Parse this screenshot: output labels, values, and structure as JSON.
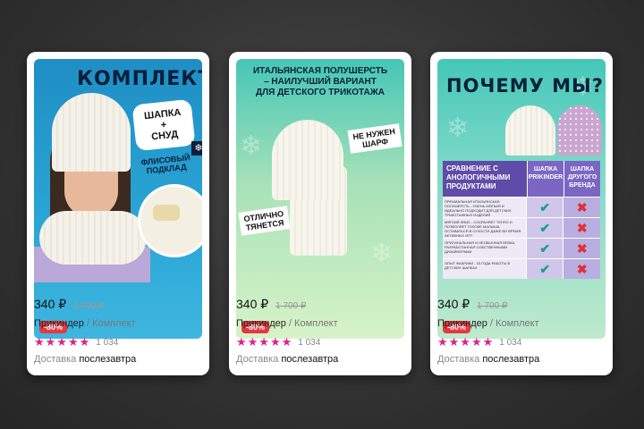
{
  "cards": [
    {
      "image": {
        "headline": "КОМПЛЕКТ",
        "bubble_line1": "ШАПКА",
        "bubble_line2": "+",
        "bubble_line3": "СНУД",
        "badge_line1": "ФЛИСОВЫЙ",
        "badge_line2": "ПОДКЛАД"
      },
      "discount": "-80%",
      "price": "340 ₽",
      "old_price": "1 700 ₽",
      "brand": "Прикиндер",
      "separator": "/",
      "category": "Комплект",
      "rating_count": "1 034",
      "delivery_label": "Доставка",
      "delivery_value": "послезавтра"
    },
    {
      "image": {
        "headline_line1": "ИТАЛЬЯНСКАЯ ПОЛУШЕРСТЬ",
        "headline_line2": "– НАИЛУЧШИЙ ВАРИАНТ",
        "headline_line3": "ДЛЯ ДЕТСКОГО ТРИКОТАЖА",
        "tag1_line1": "НЕ НУЖЕН",
        "tag1_line2": "ШАРФ",
        "tag2_line1": "ОТЛИЧНО",
        "tag2_line2": "ТЯНЕТСЯ"
      },
      "discount": "-80%",
      "price": "340 ₽",
      "old_price": "1 700 ₽",
      "brand": "Прикиндер",
      "separator": "/",
      "category": "Комплект",
      "rating_count": "1 034",
      "delivery_label": "Доставка",
      "delivery_value": "послезавтра"
    },
    {
      "image": {
        "headline": "ПОЧЕМУ МЫ?",
        "table_header": "СРАВНЕНИЕ С АНОЛОГИЧНЫМИ ПРОДУКТАМИ",
        "col1": "ШАПКА PRIKINDER",
        "col2": "ШАПКА ДРУГОГО БРЕНДА",
        "rows": [
          "ПРЕМИАЛЬНАЯ ИТАЛЬЯНСКАЯ ПОЛУШЕРСТЬ - ОЧЕНЬ МЯГКАЯ И ИДЕАЛЬНО ПОДХОДИТ ДЛЯ ДЕТСКИХ ТРИКОТАЖНЫХ ИЗДЕЛИЙ",
          "МЯГКИЙ ФЛИС - СОХРАНЯЕТ ТЕПЛО И ПОЗВОЛЯЕТ ГОЛОВЕ МАЛЫША ОСТАВАТЬСЯ В СУХОСТИ ДАЖЕ ВО ВРЕМЯ АКТИВНЫХ ИГР",
          "ОРИГИНАЛЬНАЯ И НЕОБЫЧНАЯ ВЯЗКА, РАЗРАБОТАННАЯ СОБСТВЕННЫМИ ДИЗАЙНЕРАМИ",
          "ОПЫТ ФАБРИКИ - 33 ГОДА РАБОТЫ В ДЕТСКИХ ШАПКАХ"
        ],
        "ok_mark": "✔",
        "no_mark": "✖"
      },
      "discount": "-80%",
      "price": "340 ₽",
      "old_price": "1 700 ₽",
      "brand": "Прикиндер",
      "separator": "/",
      "category": "Комплект",
      "rating_count": "1 034",
      "delivery_label": "Доставка",
      "delivery_value": "послезавтра"
    }
  ],
  "rating_stars": "★★★★★",
  "colors": {
    "star": "#e0218a",
    "discount": "#e5393f",
    "navy": "#0b1f3a"
  }
}
